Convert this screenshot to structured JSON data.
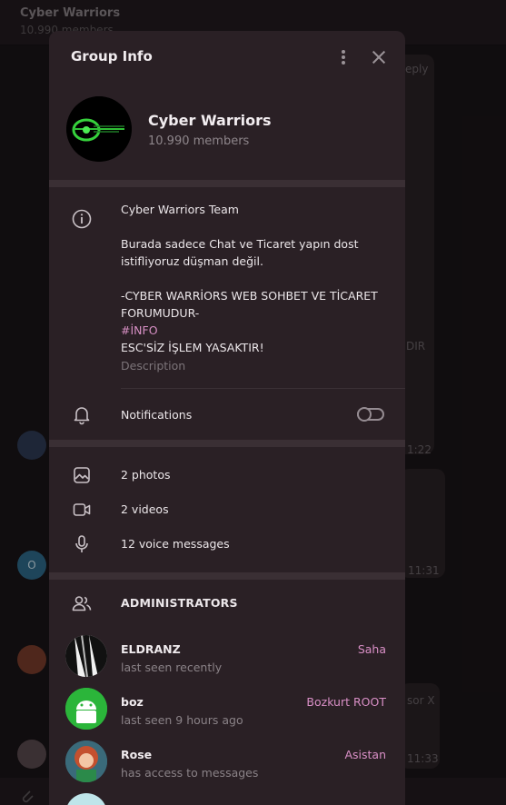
{
  "background": {
    "chat_title": "Cyber Warriors",
    "chat_sub": "10.990 members",
    "frag_reply": "eply",
    "frag_dir": "DIR",
    "frag_time1": "1:22",
    "frag_time2": "11:31",
    "frag_sor": "sor X",
    "frag_time3": "11:33",
    "frag_o": "O"
  },
  "modal": {
    "title": "Group Info",
    "group_name": "Cyber Warriors",
    "members_count": "10.990 members",
    "description": {
      "line1": "Cyber Warriors Team",
      "line2": "Burada sadece Chat ve Ticaret yapın dost",
      "line3": "istifliyoruz düşman değil.",
      "line4": "-CYBER WARRİORS WEB SOHBET VE TİCARET",
      "line5": "FORUMUDUR-",
      "hashtag": "#İNFO",
      "line6": "ESC'SİZ İŞLEM YASAKTIR!",
      "label": "Description"
    },
    "notifications_label": "Notifications",
    "notifications_on": false,
    "media": {
      "photos": "2 photos",
      "videos": "2 videos",
      "voice": "12 voice messages"
    },
    "admins_heading": "ADMINISTRATORS",
    "admins": [
      {
        "name": "ELDRANZ",
        "status": "last seen recently",
        "role": "Saha"
      },
      {
        "name": "boz",
        "status": "last seen 9 hours ago",
        "role": "Bozkurt ROOT"
      },
      {
        "name": "Rose",
        "status": "has access to messages",
        "role": "Asistan"
      }
    ]
  },
  "colors": {
    "accent": "#d98fc6",
    "panel": "#2a2025",
    "separator": "#3a2f34"
  }
}
